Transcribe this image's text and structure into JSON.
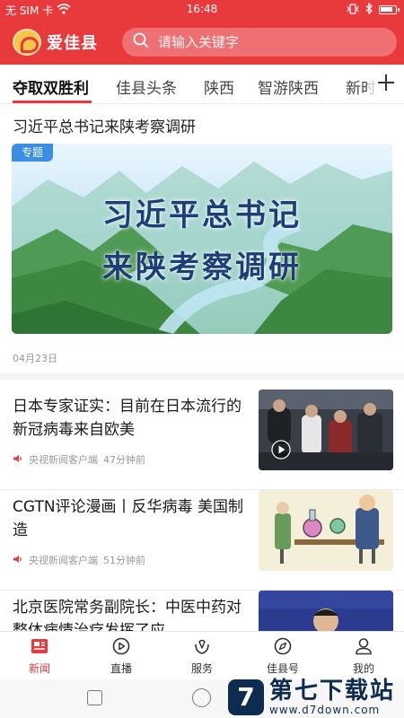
{
  "status_bar": {
    "carrier": "无 SIM 卡",
    "time": "16:48",
    "battery_level": 0.85,
    "icons": [
      "wifi-icon",
      "vibrate-icon",
      "bluetooth-icon",
      "battery-icon"
    ]
  },
  "app_bar": {
    "logo_text": "爱佳县",
    "search_placeholder": "请输入关键字",
    "accent_color": "#e83a3c"
  },
  "tabs": [
    {
      "label": "夺取双胜利",
      "active": true
    },
    {
      "label": "佳县头条",
      "active": false
    },
    {
      "label": "陕西",
      "active": false
    },
    {
      "label": "智游陕西",
      "active": false
    },
    {
      "label": "新时",
      "active": false
    }
  ],
  "feature": {
    "title": "习近平总书记来陕考察调研",
    "badge": "专题",
    "banner_lines": [
      "习近平总书记",
      "来陕考察调研"
    ],
    "date": "04月23日"
  },
  "news": [
    {
      "title": "日本专家证实：目前在日本流行的新冠病毒来自欧美",
      "source": "央视新闻客户端",
      "time": "47分钟前",
      "thumb": "airport-crowd-photo",
      "has_video": true
    },
    {
      "title": "CGTN评论漫画丨反华病毒 美国制造",
      "source": "央视新闻客户端",
      "time": "51分钟前",
      "thumb": "cartoon-illustration",
      "has_video": false
    },
    {
      "title": "北京医院常务副院长：中医中药对整体病情治疗发挥了应…",
      "source": "",
      "time": "",
      "thumb": "press-conference-photo",
      "has_video": false
    }
  ],
  "bottom_tabs": [
    {
      "label": "新闻",
      "icon": "news-icon",
      "active": true
    },
    {
      "label": "直播",
      "icon": "play-circle-icon",
      "active": false
    },
    {
      "label": "服务",
      "icon": "service-icon",
      "active": false
    },
    {
      "label": "佳县号",
      "icon": "compass-icon",
      "active": false
    },
    {
      "label": "我的",
      "icon": "user-icon",
      "active": false
    }
  ],
  "watermark": {
    "mark": "7",
    "text": "第七下载站",
    "url": "www.d7down.com"
  }
}
